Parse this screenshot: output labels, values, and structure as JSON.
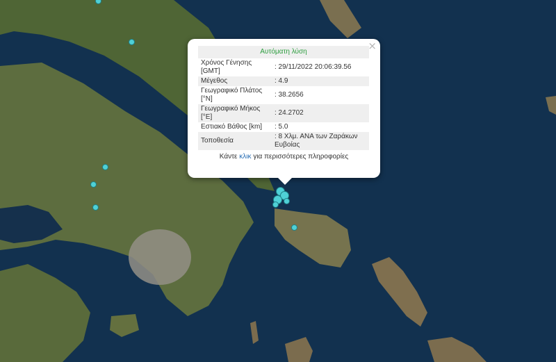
{
  "map": {
    "colors": {
      "sea": "#12314f",
      "land": "#5b6e3c",
      "land_dry": "#8a7d5b",
      "city": "#9a968d",
      "marker": "#4fd0d6"
    },
    "marker_icon": "seismic-event-circle"
  },
  "popup": {
    "header": "Αυτόματη λύση",
    "close_icon": "close-icon",
    "rows": [
      {
        "label": "Χρόνος Γένησης [GMT]",
        "value": ": 29/11/2022 20:06:39.56"
      },
      {
        "label": "Μέγεθος",
        "value": ": 4.9"
      },
      {
        "label": "Γεωγραφικό Πλάτος [°N]",
        "value": ": 38.2656"
      },
      {
        "label": "Γεωγραφικό Μήκος [°E]",
        "value": ": 24.2702"
      },
      {
        "label": "Εστιακό Βάθος [km]",
        "value": ": 5.0"
      },
      {
        "label": "Τοποθεσία",
        "value": ": 8 Χλμ. ΑΝΑ των Ζαράκων Ευβοίας"
      }
    ],
    "more_prefix": "Κάντε",
    "more_link": "κλικ",
    "more_suffix": "για περισσότερες πληροφορίες"
  }
}
